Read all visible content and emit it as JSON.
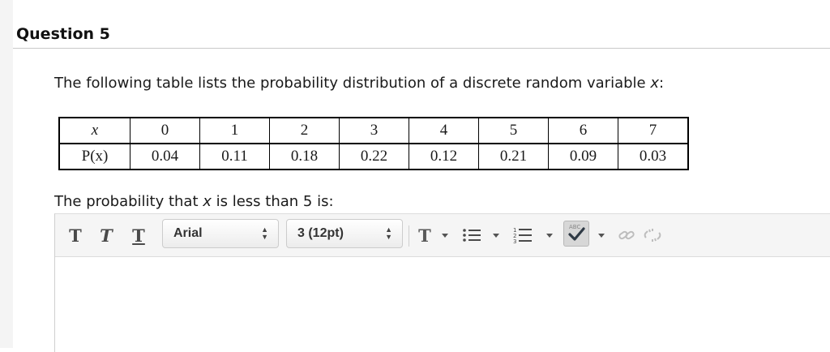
{
  "question": {
    "title": "Question 5",
    "prompt_before": "The following table lists the probability distribution of a discrete random variable ",
    "prompt_var": "x",
    "prompt_after": ":"
  },
  "distribution_table": {
    "row_headers": [
      "x",
      "P(x)"
    ],
    "x_values": [
      "0",
      "1",
      "2",
      "3",
      "4",
      "5",
      "6",
      "7"
    ],
    "p_values": [
      "0.04",
      "0.11",
      "0.18",
      "0.22",
      "0.12",
      "0.21",
      "0.09",
      "0.03"
    ]
  },
  "sub_question": {
    "before": "The probability that ",
    "var": "x",
    "after": " is less than 5 is:"
  },
  "toolbar": {
    "font_family": "Arial",
    "font_size": "3 (12pt)",
    "spell_check_caption": "ABC",
    "icons": [
      "bold-t-icon",
      "italic-t-icon",
      "underline-t-icon",
      "text-color-icon",
      "bullet-list-icon",
      "numbered-list-icon",
      "spell-check-icon",
      "link-icon",
      "unlink-icon"
    ]
  },
  "colors": {
    "rule": "#c9c9c9",
    "toolbar_bg": "#f5f5f5",
    "icon_gray": "#4a4a4a"
  }
}
